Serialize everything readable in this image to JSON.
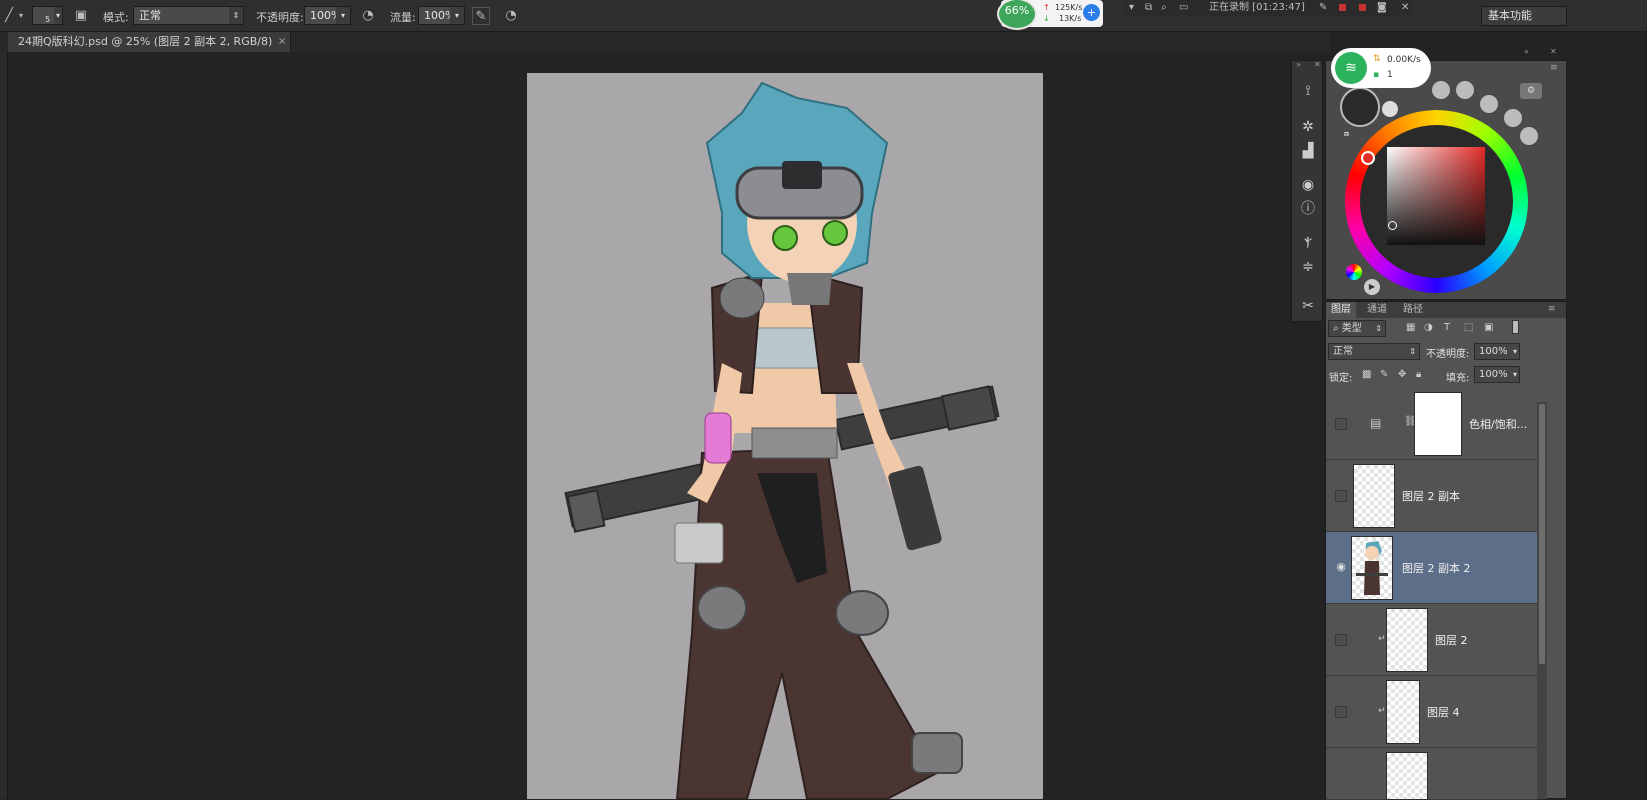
{
  "options_bar": {
    "brush_size": "5",
    "mode_label": "模式:",
    "mode_value": "正常",
    "opacity_label": "不透明度:",
    "opacity_value": "100%",
    "flow_label": "流量:",
    "flow_value": "100%"
  },
  "document_tab": {
    "title": "24期Q版科幻.psd @ 25% (图层 2 副本 2, RGB/8)",
    "close": "×"
  },
  "network_monitor": {
    "percent": "66%",
    "upload": "125K/s",
    "download": "13K/s"
  },
  "recorder": {
    "status": "正在录制 [01:23:47]"
  },
  "workspace_selector": "基本功能",
  "wifi_widget": {
    "speed": "0.00K/s",
    "count": "1"
  },
  "layers_panel": {
    "tabs": [
      "图层",
      "通道",
      "路径"
    ],
    "filter_kind": "类型",
    "blend_mode": "正常",
    "opacity_label": "不透明度:",
    "opacity_value": "100%",
    "lock_label": "锁定:",
    "fill_label": "填充:",
    "fill_value": "100%",
    "layers": [
      {
        "name": "色相/饱和...",
        "visible": false,
        "selected": false
      },
      {
        "name": "图层 2 副本",
        "visible": false,
        "selected": false
      },
      {
        "name": "图层 2 副本 2",
        "visible": true,
        "selected": true
      },
      {
        "name": "图层 2",
        "visible": false,
        "selected": false
      },
      {
        "name": "图层 4",
        "visible": false,
        "selected": false
      }
    ]
  },
  "colors": {
    "foreground": "#2a2a2a",
    "background": "#ffffff",
    "selected_layer_bg": "#5c6e88",
    "canvas_bg": "#a9a7aa"
  }
}
